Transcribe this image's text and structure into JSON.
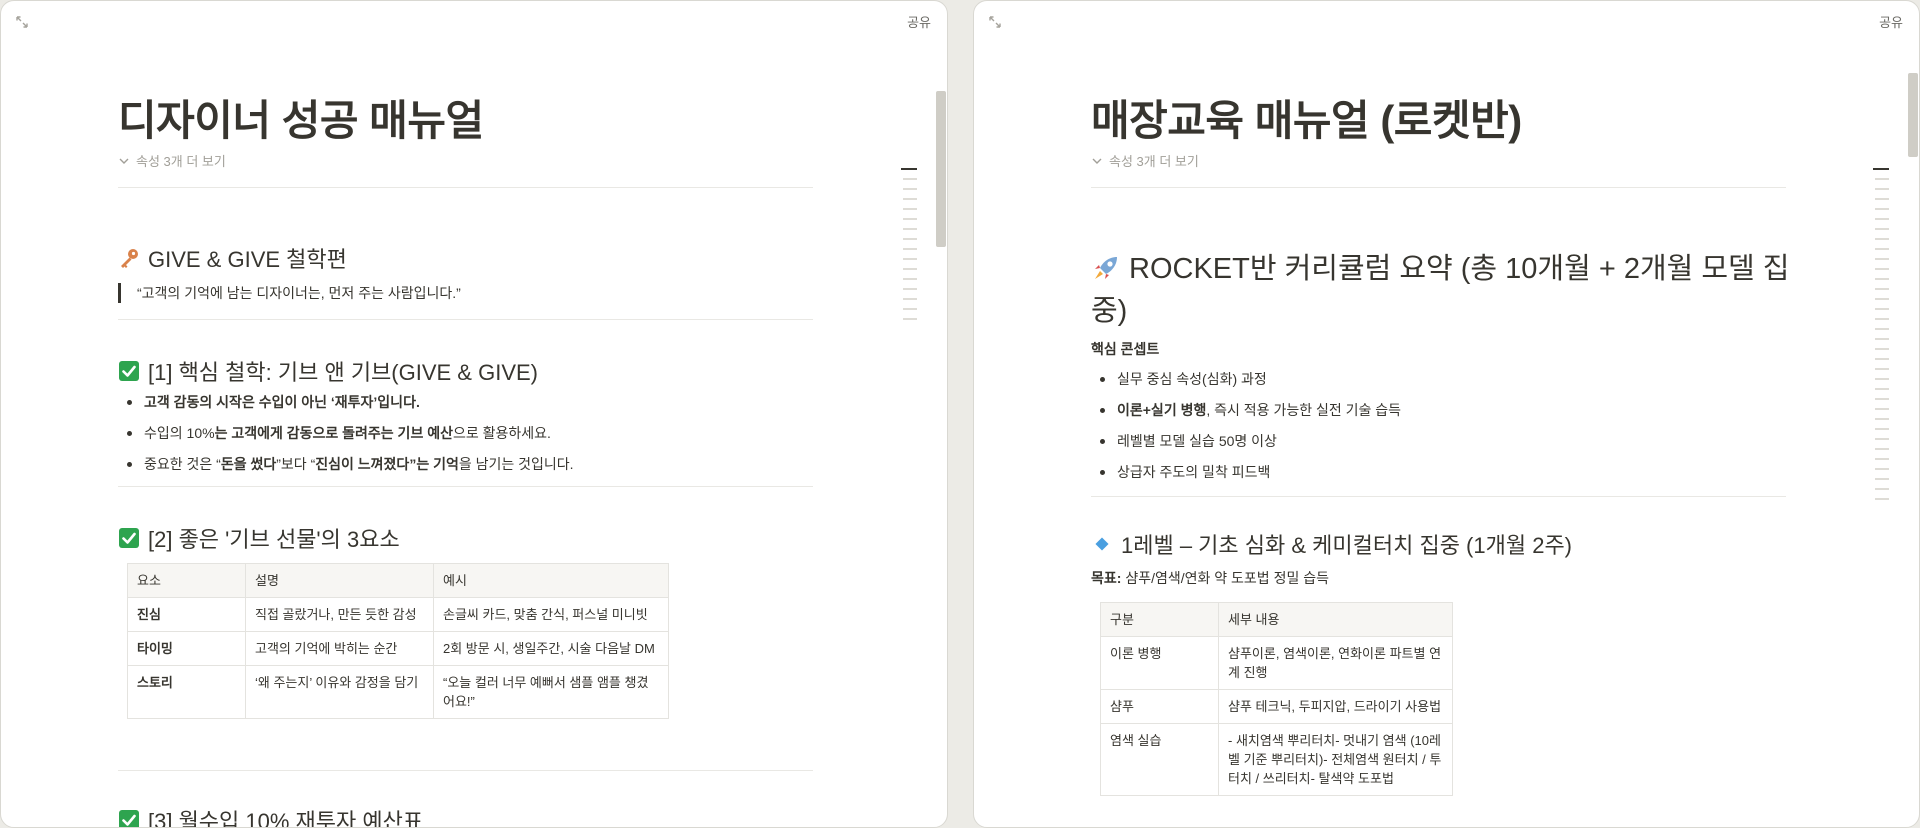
{
  "left": {
    "share_label": "공유",
    "title": "디자이너 성공 매뉴얼",
    "props_label": "속성 3개 더 보기",
    "section1": {
      "title": "GIVE & GIVE 철학편",
      "quote": "“고객의 기억에 남는 디자이너는, 먼저 주는 사람입니다.”"
    },
    "section2": {
      "title": "[1] 핵심 철학: 기브 앤 기브(GIVE & GIVE)",
      "b1": "고객 감동의 시작은 수입이 아닌 ‘재투자’입니다.",
      "b2_pre": "수입의 10%",
      "b2_b1": "는 고객에게 감동으로 돌려주는 기브 예산",
      "b2_post": "으로 활용하세요.",
      "b3_pre": "중요한 것은 “",
      "b3_b1": "돈을 썼다",
      "b3_mid": "”보다 “",
      "b3_b2": "진심이 느껴졌다",
      "b3_mid2": "”는 기억",
      "b3_post": "을 남기는 것입니다."
    },
    "section3": {
      "title": "[2] 좋은 '기브 선물'의 3요소",
      "headers": [
        "요소",
        "설명",
        "예시"
      ],
      "rows": [
        [
          "진심",
          "직접 골랐거나, 만든 듯한 감성",
          "손글씨 카드, 맞춤 간식, 퍼스널 미니빗"
        ],
        [
          "타이밍",
          "고객의 기억에 박히는 순간",
          "2회 방문 시, 생일주간, 시술 다음날 DM"
        ],
        [
          "스토리",
          "‘왜 주는지’ 이유와 감정을 담기",
          "“오늘 컬러 너무 예뻐서 샘플 앰플 챙겼어요!”"
        ]
      ]
    },
    "section4": {
      "title": "[3] 월수입 10% 재투자 예산표"
    }
  },
  "right": {
    "share_label": "공유",
    "title": "매장교육 매뉴얼 (로켓반)",
    "props_label": "속성 3개 더 보기",
    "section1": {
      "title": "ROCKET반 커리큘럼 요약 (총 10개월 + 2개월 모델 집중)",
      "concept_label": "핵심 콘셉트",
      "b1": "실무 중심 속성(심화) 과정",
      "b2_b": "이론+실기 병행",
      "b2_post": ", 즉시 적용 가능한 실전 기술 습득",
      "b3": "레벨별 모델 실습 50명 이상",
      "b4": "상급자 주도의 밀착 피드백"
    },
    "section2": {
      "title": "1레벨 – 기초 심화 & 케미컬터치 집중 (1개월 2주)",
      "goal_label": "목표:",
      "goal_text": " 샴푸/염색/연화 약 도포법 정밀 습득",
      "headers": [
        "구분",
        "세부 내용"
      ],
      "rows": [
        [
          "이론 병행",
          "샴푸이론, 염색이론, 연화이론 파트별 연계 진행"
        ],
        [
          "샴푸",
          "샴푸 테크닉, 두피지압, 드라이기 사용법"
        ],
        [
          "염색 실습",
          "- 새치염색 뿌리터치- 멋내기 염색 (10레벨 기준 뿌리터치)- 전체염색 원터치 / 투터치 / 쓰리터치- 탈색약 도포법"
        ]
      ]
    }
  },
  "colors": {
    "check_green": "#2ea44f",
    "diamond_blue": "#4a9fe0",
    "key_orange": "#d9824b"
  }
}
